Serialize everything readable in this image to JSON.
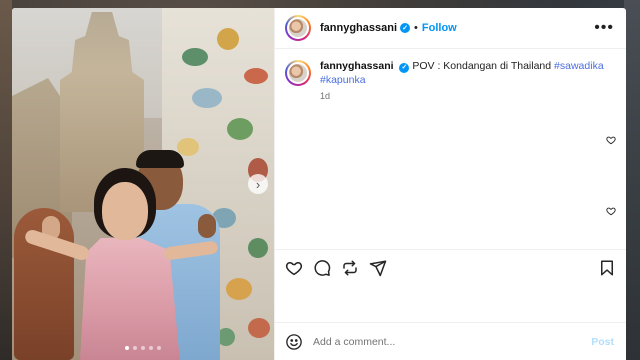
{
  "post": {
    "username": "fannyghassani",
    "follow_label": "Follow",
    "separator": "•",
    "more_label": "•••",
    "verified_mark": "✓",
    "caption": {
      "username": "fannyghassani",
      "text": "POV : Kondangan di Thailand",
      "hashtags": [
        "#sawadika",
        "#kapunka"
      ]
    },
    "time": "1d"
  },
  "carousel": {
    "next_arrow": "›",
    "dot_count": 5,
    "active_dot": 1
  },
  "actions": {
    "icons": [
      "heart-icon",
      "comment-icon",
      "share-icon",
      "send-icon",
      "bookmark-icon"
    ]
  },
  "comment_box": {
    "placeholder": "Add a comment...",
    "post_label": "Post"
  },
  "colors": {
    "accent": "#0095f6",
    "hashtag": "#4a6ee0",
    "post_disabled": "#b2dffc"
  }
}
